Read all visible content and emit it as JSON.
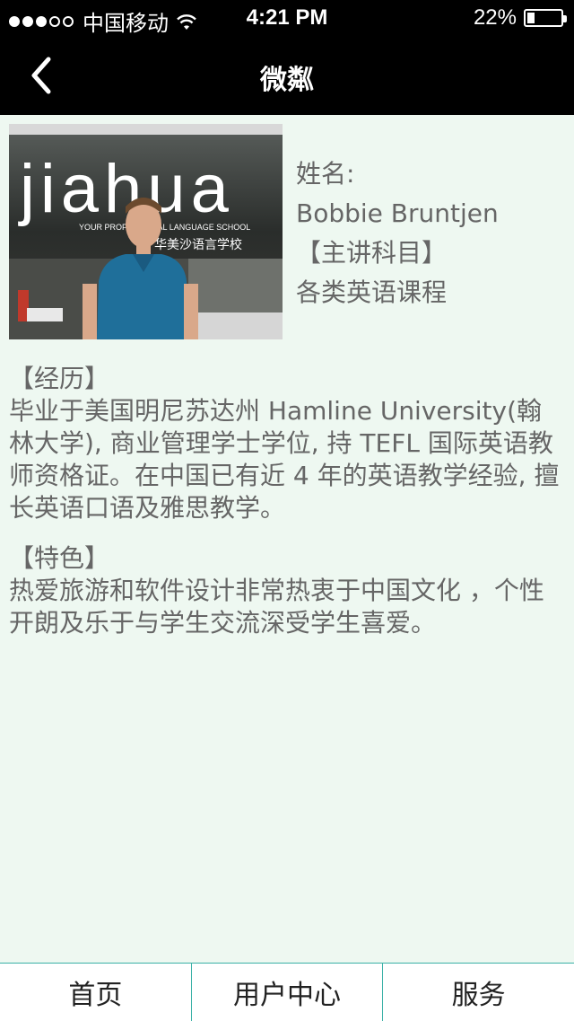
{
  "status_bar": {
    "carrier": "中国移动",
    "time": "4:21 PM",
    "battery": "22%",
    "battery_level": 0.22
  },
  "nav": {
    "title": "微粼",
    "back_icon": "chevron-left-icon"
  },
  "teacher": {
    "name_label": "姓名:",
    "name": "Bobbie Bruntjen",
    "subject_label": "【主讲科目】",
    "subject": "各类英语课程"
  },
  "photo": {
    "sign_text": "jiahua",
    "sign_sub": "YOUR PROFESSIONAL LANGUAGE SCHOOL",
    "sign_cn": "华美沙语言学校"
  },
  "experience": {
    "label": "【经历】",
    "text": "毕业于美国明尼苏达州 Hamline University(翰林大学), 商业管理学士学位, 持 TEFL 国际英语教师资格证。在中国已有近 4 年的英语教学经验, 擅长英语口语及雅思教学。"
  },
  "features": {
    "label": "【特色】",
    "text": "热爱旅游和软件设计非常热衷于中国文化 ，个性开朗及乐于与学生交流深受学生喜爱。"
  },
  "tabs": [
    {
      "label": "首页"
    },
    {
      "label": "用户中心"
    },
    {
      "label": "服务"
    }
  ]
}
